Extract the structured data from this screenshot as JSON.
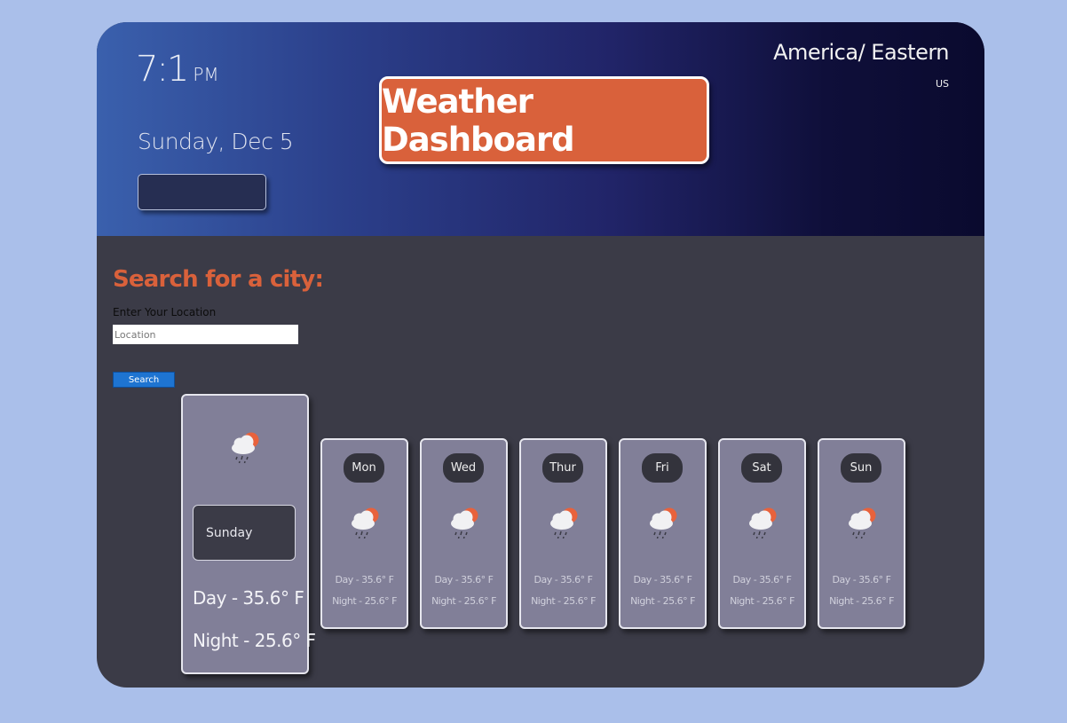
{
  "header": {
    "time": "7:1",
    "ampm": "PM",
    "date": "Sunday, Dec 5",
    "title": "Weather Dashboard",
    "timezone": "America/ Eastern",
    "country": "US"
  },
  "search": {
    "heading": "Search for a city:",
    "label": "Enter Your Location",
    "placeholder": "Location",
    "button_label": "Search"
  },
  "today": {
    "day": "Sunday",
    "day_temp": "Day - 35.6° F",
    "night_temp": "Night - 25.6° F",
    "icon": "rain-cloud-sun-icon"
  },
  "forecast": [
    {
      "day": "Mon",
      "day_temp": "Day - 35.6° F",
      "night_temp": "Night - 25.6° F",
      "icon": "rain-cloud-sun-icon"
    },
    {
      "day": "Wed",
      "day_temp": "Day - 35.6° F",
      "night_temp": "Night - 25.6° F",
      "icon": "rain-cloud-sun-icon"
    },
    {
      "day": "Thur",
      "day_temp": "Day - 35.6° F",
      "night_temp": "Night - 25.6° F",
      "icon": "rain-cloud-sun-icon"
    },
    {
      "day": "Fri",
      "day_temp": "Day - 35.6° F",
      "night_temp": "Night - 25.6° F",
      "icon": "rain-cloud-sun-icon"
    },
    {
      "day": "Sat",
      "day_temp": "Day - 35.6° F",
      "night_temp": "Night - 25.6° F",
      "icon": "rain-cloud-sun-icon"
    },
    {
      "day": "Sun",
      "day_temp": "Day - 35.6° F",
      "night_temp": "Night - 25.6° F",
      "icon": "rain-cloud-sun-icon"
    }
  ],
  "colors": {
    "page_background": "#aabfea",
    "panel_background": "#3b3b47",
    "accent": "#d9613b",
    "card": "#817f98",
    "button": "#1e74d1"
  }
}
